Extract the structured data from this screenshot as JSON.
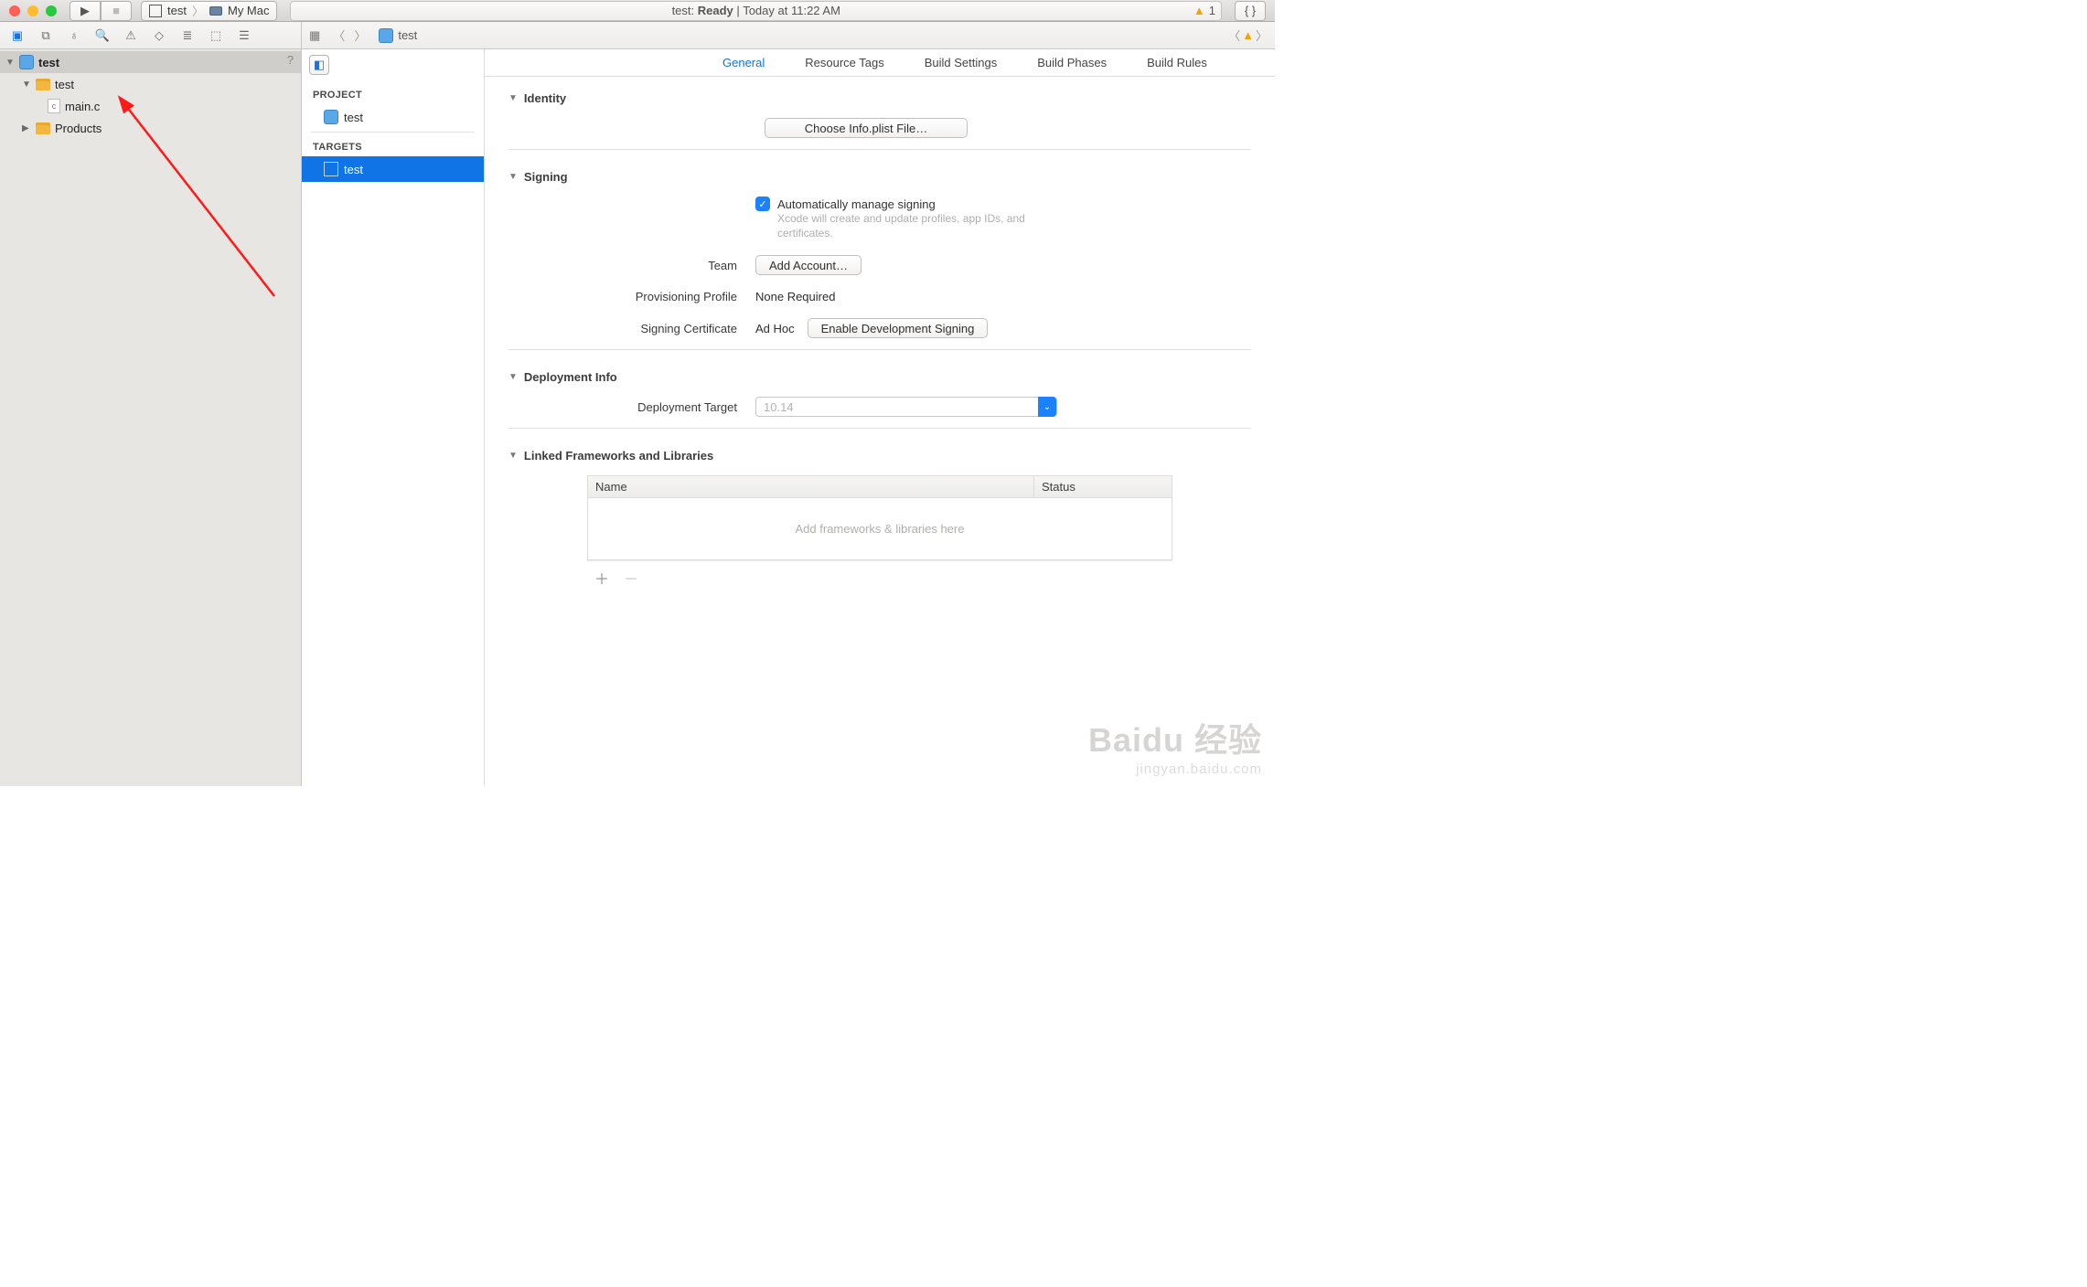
{
  "titlebar": {
    "scheme_target": "test",
    "scheme_device": "My Mac",
    "lcd_prefix": "test:",
    "lcd_status": "Ready",
    "lcd_sep": "|",
    "lcd_time": "Today at 11:22 AM",
    "warning_count": "1"
  },
  "navigator": {
    "root": "test",
    "folder": "test",
    "file": "main.c",
    "file_badge": "c",
    "products": "Products",
    "help": "?"
  },
  "crumb": {
    "item": "test"
  },
  "outline": {
    "project_header": "PROJECT",
    "project_item": "test",
    "targets_header": "TARGETS",
    "target_item": "test"
  },
  "tabs": {
    "general": "General",
    "resource_tags": "Resource Tags",
    "build_settings": "Build Settings",
    "build_phases": "Build Phases",
    "build_rules": "Build Rules"
  },
  "identity": {
    "title": "Identity",
    "choose_plist": "Choose Info.plist File…"
  },
  "signing": {
    "title": "Signing",
    "auto_label": "Automatically manage signing",
    "auto_hint": "Xcode will create and update profiles, app IDs, and certificates.",
    "team_label": "Team",
    "team_btn": "Add Account…",
    "profile_label": "Provisioning Profile",
    "profile_value": "None Required",
    "cert_label": "Signing Certificate",
    "cert_value": "Ad Hoc",
    "enable_dev": "Enable Development Signing"
  },
  "deployment": {
    "title": "Deployment Info",
    "target_label": "Deployment Target",
    "target_placeholder": "10.14"
  },
  "linked": {
    "title": "Linked Frameworks and Libraries",
    "col_name": "Name",
    "col_status": "Status",
    "placeholder": "Add frameworks & libraries here"
  },
  "watermark": {
    "brand": "Baidu 经验",
    "sub": "jingyan.baidu.com"
  }
}
